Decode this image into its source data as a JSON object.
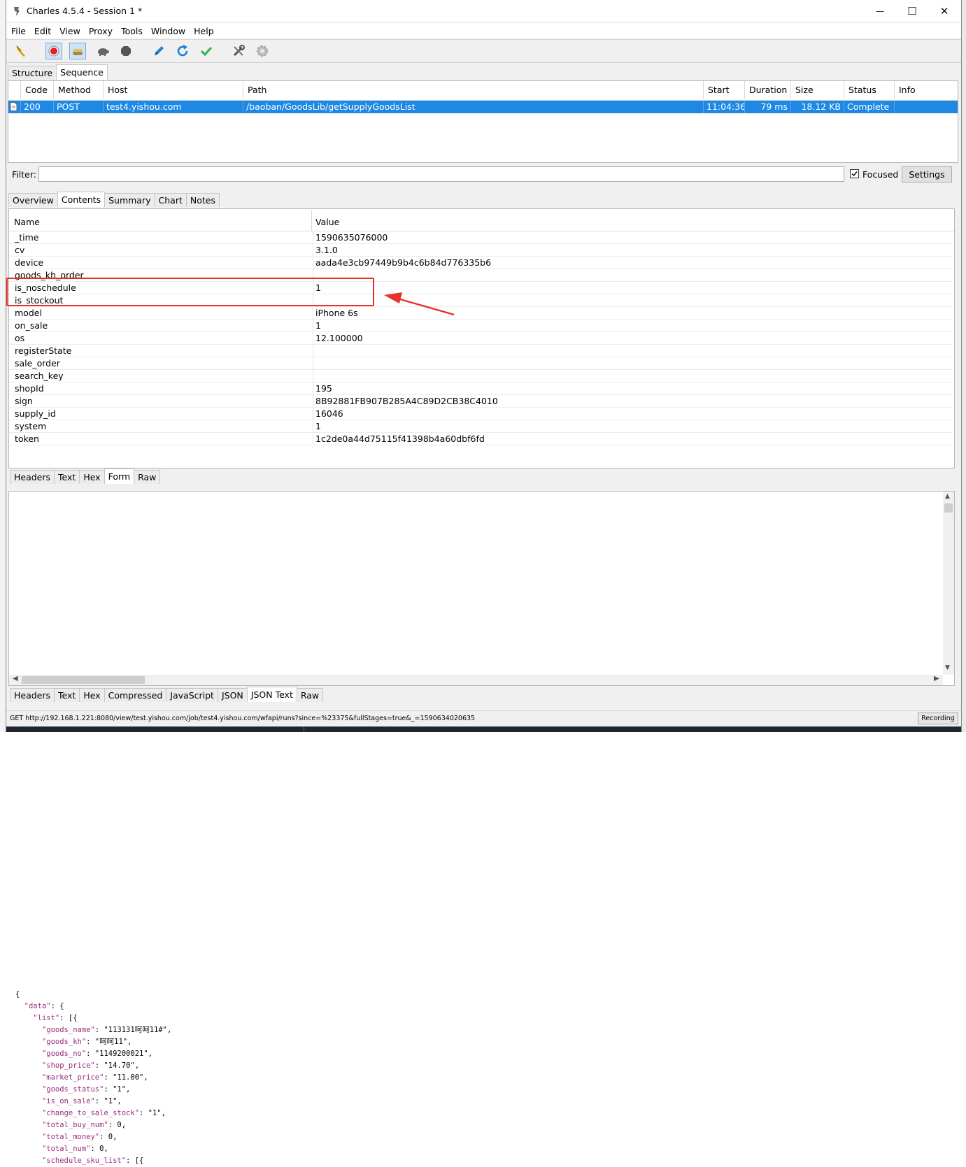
{
  "window": {
    "title": "Charles 4.5.4 - Session 1 *",
    "minimize_glyph": "—",
    "maximize_glyph": "☐",
    "close_glyph": "✕"
  },
  "menu": [
    "File",
    "Edit",
    "View",
    "Proxy",
    "Tools",
    "Window",
    "Help"
  ],
  "top_tabs": {
    "structure": "Structure",
    "sequence": "Sequence"
  },
  "sequence": {
    "columns": [
      "Code",
      "Method",
      "Host",
      "Path",
      "Start",
      "Duration",
      "Size",
      "Status",
      "Info"
    ],
    "rows": [
      {
        "code": "200",
        "method": "POST",
        "host": "test4.yishou.com",
        "path": "/baoban/GoodsLib/getSupplyGoodsList",
        "start": "11:04:36",
        "duration": "79 ms",
        "size": "18.12 KB",
        "status": "Complete",
        "info": ""
      }
    ]
  },
  "filter": {
    "label": "Filter:",
    "value": "",
    "focused_label": "Focused",
    "settings_label": "Settings",
    "focused_checked": true
  },
  "detail_tabs": [
    "Overview",
    "Contents",
    "Summary",
    "Chart",
    "Notes"
  ],
  "form": {
    "header_name": "Name",
    "header_value": "Value",
    "rows": [
      {
        "name": "_time",
        "value": "1590635076000"
      },
      {
        "name": "cv",
        "value": "3.1.0"
      },
      {
        "name": "device",
        "value": "aada4e3cb97449b9b4c6b84d776335b6"
      },
      {
        "name": "goods_kh_order",
        "value": ""
      },
      {
        "name": "is_noschedule",
        "value": "1"
      },
      {
        "name": "is_stockout",
        "value": ""
      },
      {
        "name": "model",
        "value": "iPhone 6s"
      },
      {
        "name": "on_sale",
        "value": "1"
      },
      {
        "name": "os",
        "value": "12.100000"
      },
      {
        "name": "registerState",
        "value": ""
      },
      {
        "name": "sale_order",
        "value": ""
      },
      {
        "name": "search_key",
        "value": ""
      },
      {
        "name": "shopId",
        "value": "195"
      },
      {
        "name": "sign",
        "value": "8B92881FB907B285A4C89D2CB38C4010"
      },
      {
        "name": "supply_id",
        "value": "16046"
      },
      {
        "name": "system",
        "value": "1"
      },
      {
        "name": "token",
        "value": "1c2de0a44d75115f41398b4a60dbf6fd"
      }
    ]
  },
  "request_tabs": [
    "Headers",
    "Text",
    "Hex",
    "Form",
    "Raw"
  ],
  "response_json": [
    {
      "indent": 0,
      "key": "",
      "val": "{"
    },
    {
      "indent": 1,
      "key": "\"data\"",
      "val": ": {"
    },
    {
      "indent": 2,
      "key": "\"list\"",
      "val": ": [{"
    },
    {
      "indent": 3,
      "key": "\"goods_name\"",
      "val": ": \"113131呵呵11#\","
    },
    {
      "indent": 3,
      "key": "\"goods_kh\"",
      "val": ": \"呵呵11\","
    },
    {
      "indent": 3,
      "key": "\"goods_no\"",
      "val": ": \"1149200021\","
    },
    {
      "indent": 3,
      "key": "\"shop_price\"",
      "val": ": \"14.70\","
    },
    {
      "indent": 3,
      "key": "\"market_price\"",
      "val": ": \"11.00\","
    },
    {
      "indent": 3,
      "key": "\"goods_status\"",
      "val": ": \"1\","
    },
    {
      "indent": 3,
      "key": "\"is_on_sale\"",
      "val": ": \"1\","
    },
    {
      "indent": 3,
      "key": "\"change_to_sale_stock\"",
      "val": ": \"1\","
    },
    {
      "indent": 3,
      "key": "\"total_buy_num\"",
      "val": ": 0,"
    },
    {
      "indent": 3,
      "key": "\"total_money\"",
      "val": ": 0,"
    },
    {
      "indent": 3,
      "key": "\"total_num\"",
      "val": ": 0,"
    },
    {
      "indent": 3,
      "key": "\"schedule_sku_list\"",
      "val": ": [{"
    }
  ],
  "response_tabs": [
    "Headers",
    "Text",
    "Hex",
    "Compressed",
    "JavaScript",
    "JSON",
    "JSON Text",
    "Raw"
  ],
  "statusbar": {
    "text": "GET http://192.168.1.221:8080/view/test.yishou.com/job/test4.yishou.com/wfapi/runs?since=%23375&fullStages=true&_=1590634020635",
    "recording": "Recording"
  },
  "colors": {
    "selection": "#1e88e5",
    "annotation": "#e8302a"
  }
}
